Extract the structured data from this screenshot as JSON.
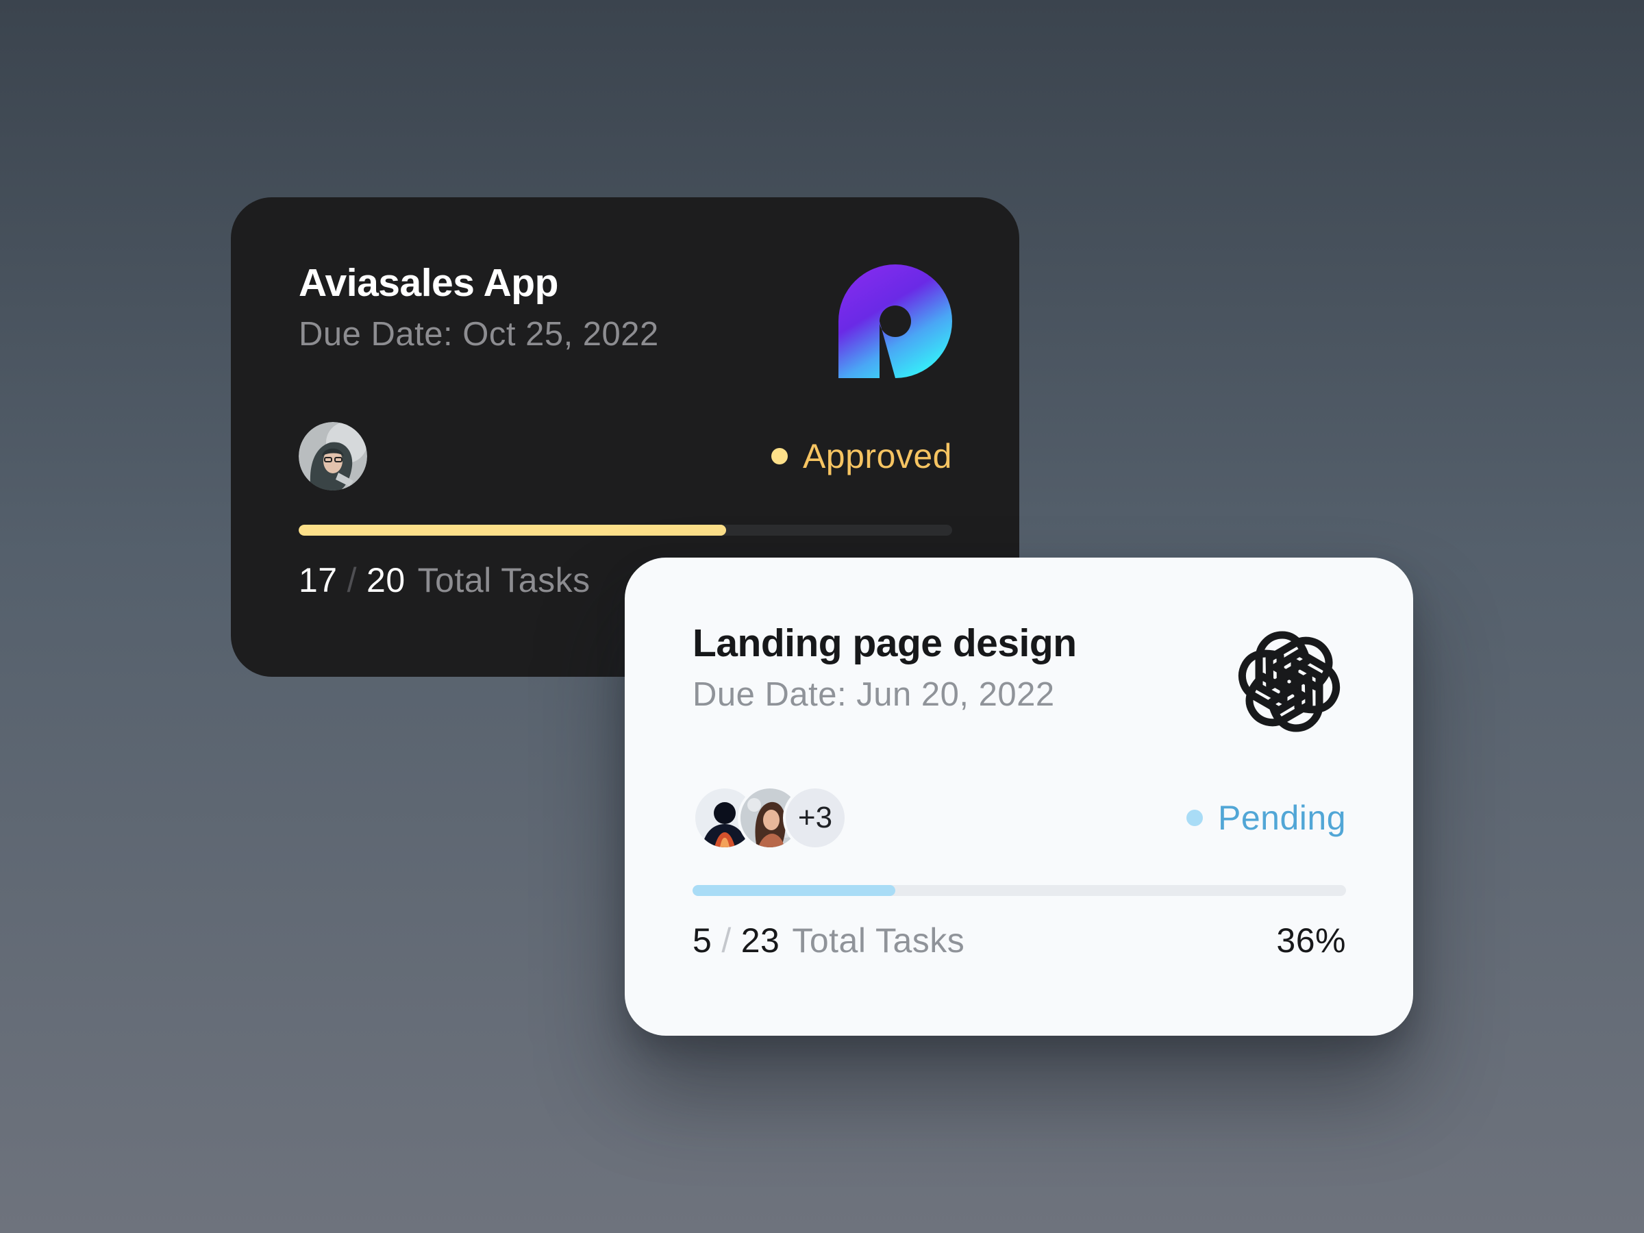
{
  "cards": [
    {
      "title": "Aviasales App",
      "due_date": "Due Date: Oct 25, 2022",
      "logo_icon": "aviasales-logo-icon",
      "status": "Approved",
      "status_color": "#F6C462",
      "progress_fraction": 0.654,
      "progress_color": "#FDE08A",
      "tasks_done": "17",
      "tasks_separator": "/",
      "tasks_total": "20",
      "tasks_label": "Total Tasks",
      "members": [
        "avatar-woman-hijab"
      ]
    },
    {
      "title": "Landing page design",
      "due_date": "Due Date: Jun 20, 2022",
      "logo_icon": "openai-logo-icon",
      "status": "Pending",
      "status_color": "#51A6D6",
      "progress_fraction": 0.31,
      "progress_color": "#A9DCF6",
      "tasks_done": "5",
      "tasks_separator": "/",
      "tasks_total": "23",
      "tasks_label": "Total Tasks",
      "percent": "36%",
      "members": [
        "avatar-silhouette",
        "avatar-woman"
      ],
      "more_members": "+3"
    }
  ]
}
